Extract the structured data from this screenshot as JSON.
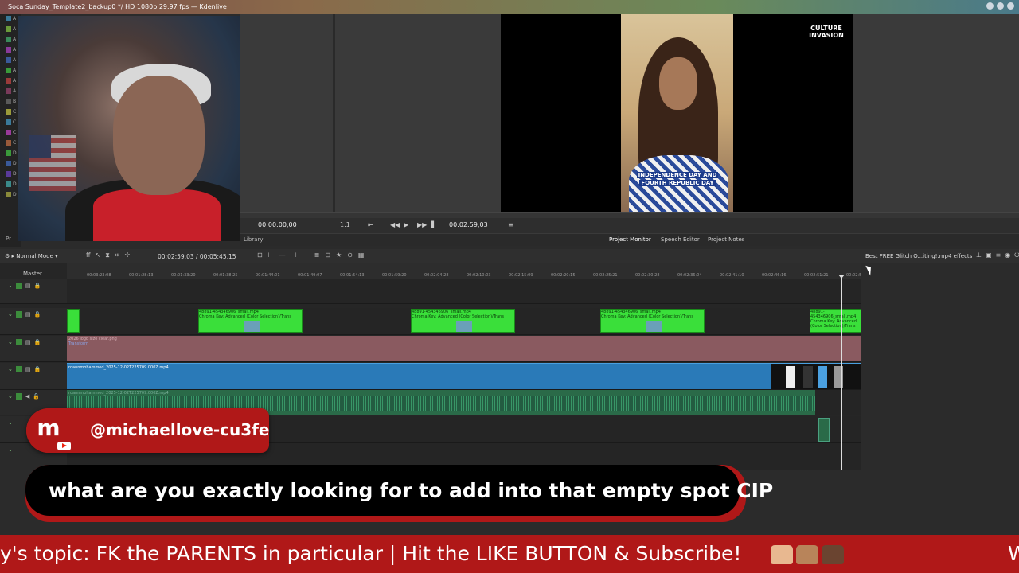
{
  "window": {
    "title": "Soca Sunday_Template2_backup0 */ HD 1080p 29.97 fps — Kdenlive"
  },
  "monitor": {
    "caption_line1": "INDEPENDENCE DAY AND",
    "caption_line2": "FOURTH REPUBLIC DAY",
    "logo_line1": "CULTURE",
    "logo_line2": "INVASION"
  },
  "monitor_toolbar": {
    "clip_timecode": "00:00:00,00",
    "zoom": "1:1",
    "project_timecode": "00:02:59,03"
  },
  "tabs": {
    "library": "Library",
    "project_monitor": "Project Monitor",
    "speech_editor": "Speech Editor",
    "project_notes": "Project Notes",
    "panel_short": "Pr..."
  },
  "timeline_toolbar": {
    "mode": "Normal Mode",
    "position": "00:02:59,03 / 00:05:45,15",
    "effects_label": "Best FREE Glitch O...iting!.mp4 effects"
  },
  "timeline": {
    "master_label": "Master",
    "ruler": [
      "00:03:23:08",
      "00:01:28:13",
      "00:01:33:20",
      "00:01:38:25",
      "00:01:44:01",
      "00:01:49:07",
      "00:01:54:13",
      "00:01:59:20",
      "00:02:04:28",
      "00:02:10:03",
      "00:02:15:09",
      "00:02:20:15",
      "00:02:25:21",
      "00:02:30:28",
      "00:02:36:04",
      "00:02:41:10",
      "00:02:46:16",
      "00:02:51:21",
      "00:02:5"
    ],
    "green_clip_label": "48891-454346906_small.mp4",
    "green_clip_sub": "Chroma Key: Advanced (Color Selection)/Trans",
    "logo_clip_label": "2026 logo size clear.png",
    "logo_clip_sub": "Transform",
    "video_clip_label": "roannmohammed_2025-12-02T225709.000Z.mp4",
    "audio_clip_label": "roannmohammed_2025-12-02T225709.000Z.mp4"
  },
  "overlay": {
    "avatar_letter": "m",
    "username": "@michaellove-cu3fe",
    "message": "what are you exactly looking for to add into that empty spot CIP",
    "ticker": "y's topic:  FK the PARENTS in particular | Hit the LIKE BUTTON & Subscribe!",
    "ticker_tail": "W"
  },
  "colors": {
    "accent_red": "#b01818",
    "clip_green": "#3adf3a",
    "clip_blue": "#2a7ab8"
  }
}
